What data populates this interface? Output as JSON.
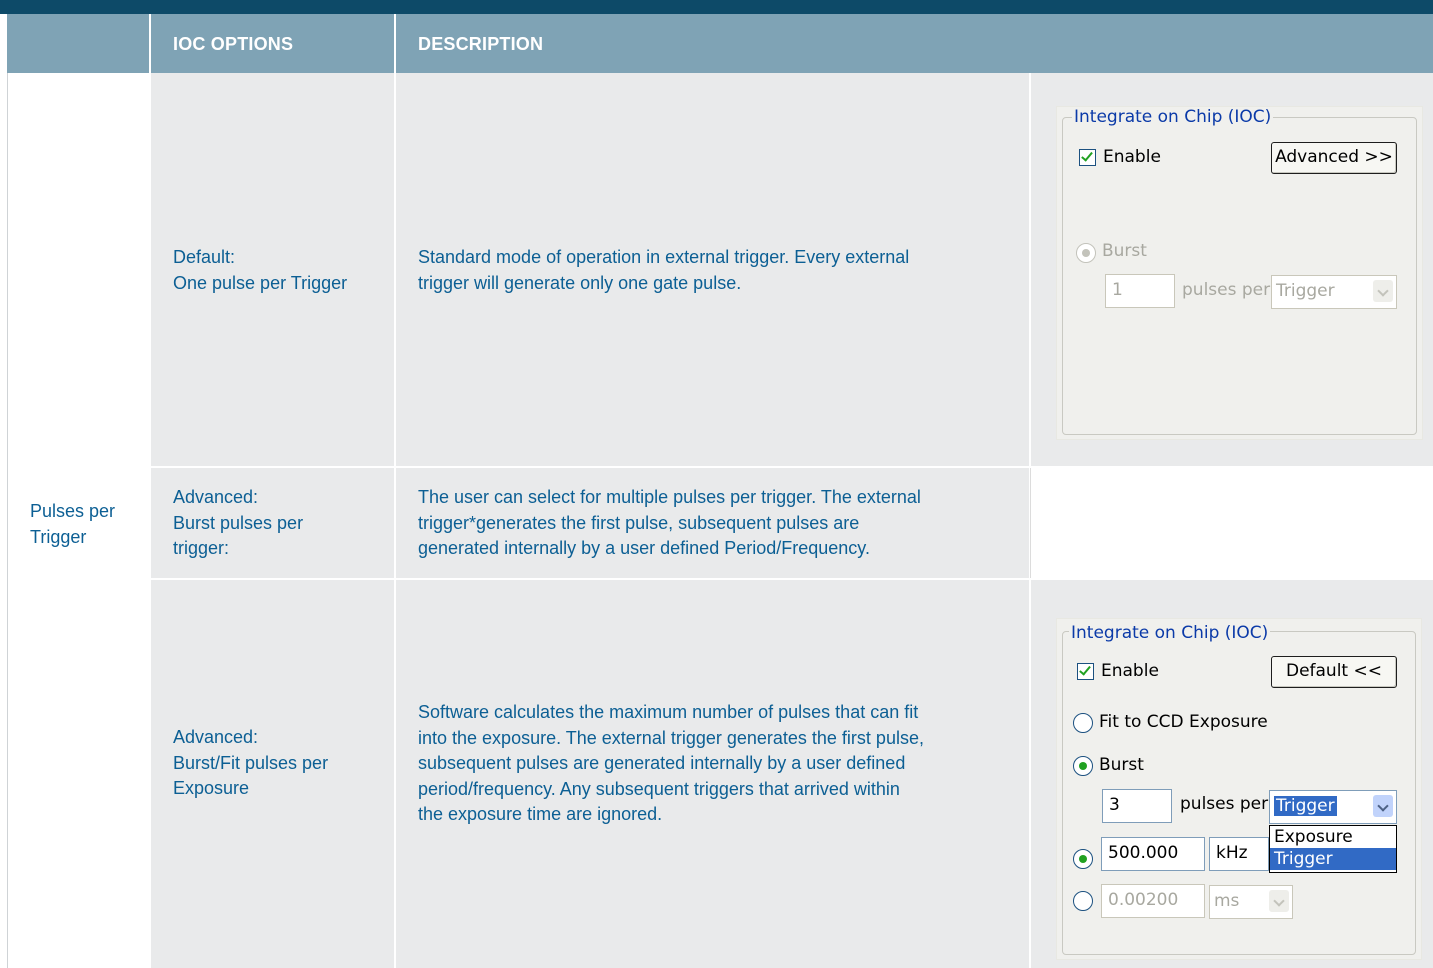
{
  "header": {
    "col1": "",
    "col2": "IOC OPTIONS",
    "col3": "DESCRIPTION"
  },
  "row_group_label": "Pulses per\nTrigger",
  "rows": [
    {
      "option": "Default:\nOne pulse per Trigger",
      "description": "Standard mode of operation in external trigger. Every external\ntrigger will generate only one gate pulse."
    },
    {
      "option": "Advanced:\nBurst pulses per\ntrigger:",
      "description": "The user can select for multiple pulses per trigger. The external\ntrigger*generates the first pulse, subsequent pulses are\ngenerated internally by a user defined Period/Frequency."
    },
    {
      "option": "Advanced:\nBurst/Fit pulses per\nExposure",
      "description": "Software calculates the maximum number of pulses that can fit\ninto the exposure. The external trigger generates the first pulse,\nsubsequent pulses are generated internally by a user defined\nperiod/frequency. Any subsequent triggers that arrived within\nthe exposure time are ignored."
    }
  ],
  "dialog1": {
    "group_title": "Integrate on Chip (IOC)",
    "enable_label": "Enable",
    "enable_checked": true,
    "advanced_button": "Advanced >>",
    "burst_label": "Burst",
    "pulses_value": "1",
    "pulses_per_label": "pulses per",
    "per_select": "Trigger"
  },
  "dialog2": {
    "group_title": "Integrate on Chip (IOC)",
    "enable_label": "Enable",
    "enable_checked": true,
    "default_button": "Default <<",
    "fit_label": "Fit to CCD Exposure",
    "burst_label": "Burst",
    "pulses_value": "3",
    "pulses_per_label": "pulses per",
    "per_select": "Trigger",
    "dropdown_options": [
      "Exposure",
      "Trigger"
    ],
    "dropdown_selected": "Trigger",
    "freq_value": "500.000",
    "freq_unit": "kHz",
    "period_value": "0.00200",
    "period_unit": "ms"
  },
  "colors": {
    "top_bar": "#0d4a68",
    "header_bg": "#7fa3b5",
    "cell_bg": "#e9eaeb",
    "text_blue": "#0c5f94"
  }
}
